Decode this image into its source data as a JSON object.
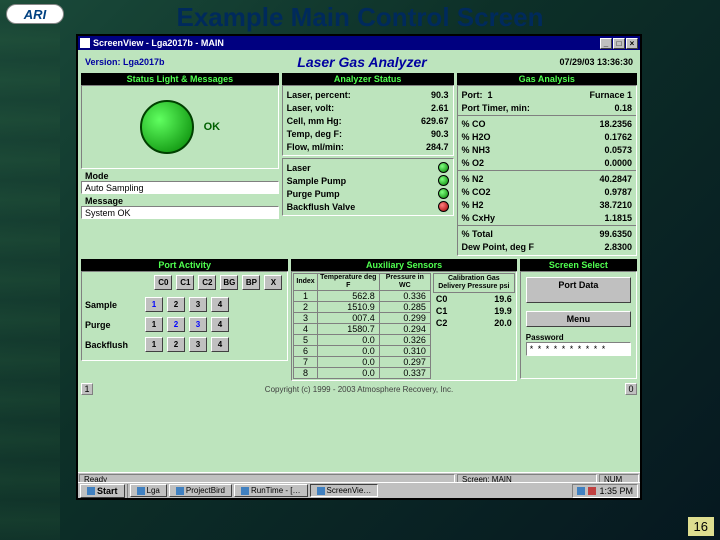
{
  "slide": {
    "logo": "ARI",
    "title": "Example Main Control Screen",
    "page_number": "16"
  },
  "window": {
    "title": "ScreenView - Lga2017b - MAIN",
    "header": {
      "version_label": "Version: Lga2017b",
      "app_title": "Laser Gas Analyzer",
      "datetime": "07/29/03  13:36:30"
    },
    "status_panel": {
      "header": "Status Light & Messages",
      "ok_text": "OK",
      "mode_label": "Mode",
      "mode_value": "Auto Sampling",
      "message_label": "Message",
      "message_value": "System OK"
    },
    "analyzer": {
      "header": "Analyzer Status",
      "rows": [
        {
          "lbl": "Laser, percent:",
          "val": "90.3"
        },
        {
          "lbl": "Laser, volt:",
          "val": "2.61"
        },
        {
          "lbl": "Cell, mm Hg:",
          "val": " 629.67"
        },
        {
          "lbl": "Temp, deg F:",
          "val": " 90.3"
        },
        {
          "lbl": "Flow, ml/min:",
          "val": " 284.7"
        }
      ],
      "leds": [
        {
          "lbl": "Laser",
          "c": "g"
        },
        {
          "lbl": "Sample Pump",
          "c": "g"
        },
        {
          "lbl": "Purge Pump",
          "c": "g"
        },
        {
          "lbl": "Backflush Valve",
          "c": "r"
        }
      ]
    },
    "gas": {
      "header": "Gas Analysis",
      "port_label": "Port:",
      "port_value": "1",
      "port_name": "Furnace 1",
      "timer_label": "Port Timer, min:",
      "timer_value": "0.18",
      "rows": [
        {
          "lbl": "% CO",
          "val": "18.2356"
        },
        {
          "lbl": "% H2O",
          "val": "0.1762"
        },
        {
          "lbl": "% NH3",
          "val": "0.0573"
        },
        {
          "lbl": "% O2",
          "val": "0.0000"
        },
        {
          "lbl": "% N2",
          "val": "40.2847"
        },
        {
          "lbl": "% CO2",
          "val": "0.9787"
        },
        {
          "lbl": "% H2",
          "val": "38.7210"
        },
        {
          "lbl": "% CxHy",
          "val": "1.1815"
        },
        {
          "lbl": "% Total",
          "val": "99.6350"
        },
        {
          "lbl": "Dew Point, deg F",
          "val": "2.8300"
        }
      ]
    },
    "port_activity": {
      "header": "Port Activity",
      "col_headers": [
        "C0",
        "C1",
        "C2",
        "BG",
        "BP",
        "X"
      ],
      "rows": [
        {
          "lbl": "Sample",
          "btns": [
            {
              "t": "1",
              "on": true
            },
            {
              "t": "2"
            },
            {
              "t": "3"
            },
            {
              "t": "4"
            }
          ]
        },
        {
          "lbl": "Purge",
          "btns": [
            {
              "t": "1"
            },
            {
              "t": "2",
              "on": true
            },
            {
              "t": "3",
              "on": true
            },
            {
              "t": "4"
            }
          ]
        },
        {
          "lbl": "Backflush",
          "btns": [
            {
              "t": "1"
            },
            {
              "t": "2"
            },
            {
              "t": "3"
            },
            {
              "t": "4"
            }
          ]
        }
      ]
    },
    "aux": {
      "header": "Auxiliary Sensors",
      "cols": [
        "Index",
        "Temperature deg F",
        "Pressure in WC",
        "Calibration Gas Delivery Pressure psi"
      ],
      "rows": [
        {
          "i": "1",
          "t": "562.8",
          "p": "0.336"
        },
        {
          "i": "2",
          "t": "1510.9",
          "p": "0.285"
        },
        {
          "i": "3",
          "t": "007.4",
          "p": "0.299"
        },
        {
          "i": "4",
          "t": "1580.7",
          "p": "0.294"
        },
        {
          "i": "5",
          "t": "0.0",
          "p": "0.326"
        },
        {
          "i": "6",
          "t": "0.0",
          "p": "0.310"
        },
        {
          "i": "7",
          "t": "0.0",
          "p": "0.297"
        },
        {
          "i": "8",
          "t": "0.0",
          "p": "0.337"
        }
      ],
      "cal": [
        {
          "lbl": "C0",
          "val": "19.6"
        },
        {
          "lbl": "C1",
          "val": "19.9"
        },
        {
          "lbl": "C2",
          "val": "20.0"
        }
      ]
    },
    "screen_select": {
      "header": "Screen Select",
      "port_data_btn": "Port Data",
      "menu_btn": "Menu",
      "password_label": "Password",
      "password_value": "* * * * * * * * * *"
    },
    "copyright": "Copyright  (c)  1999 - 2003    Atmosphere Recovery, Inc.",
    "scroll_left": "1",
    "scroll_right": "0",
    "statusbar": {
      "ready": "Ready",
      "screen": "Screen: MAIN",
      "num": "NUM"
    }
  },
  "taskbar": {
    "start": "Start",
    "items": [
      "Lga",
      "ProjectBird",
      "RunTime - […",
      "ScreenVie…"
    ],
    "clock": "1:35 PM"
  }
}
